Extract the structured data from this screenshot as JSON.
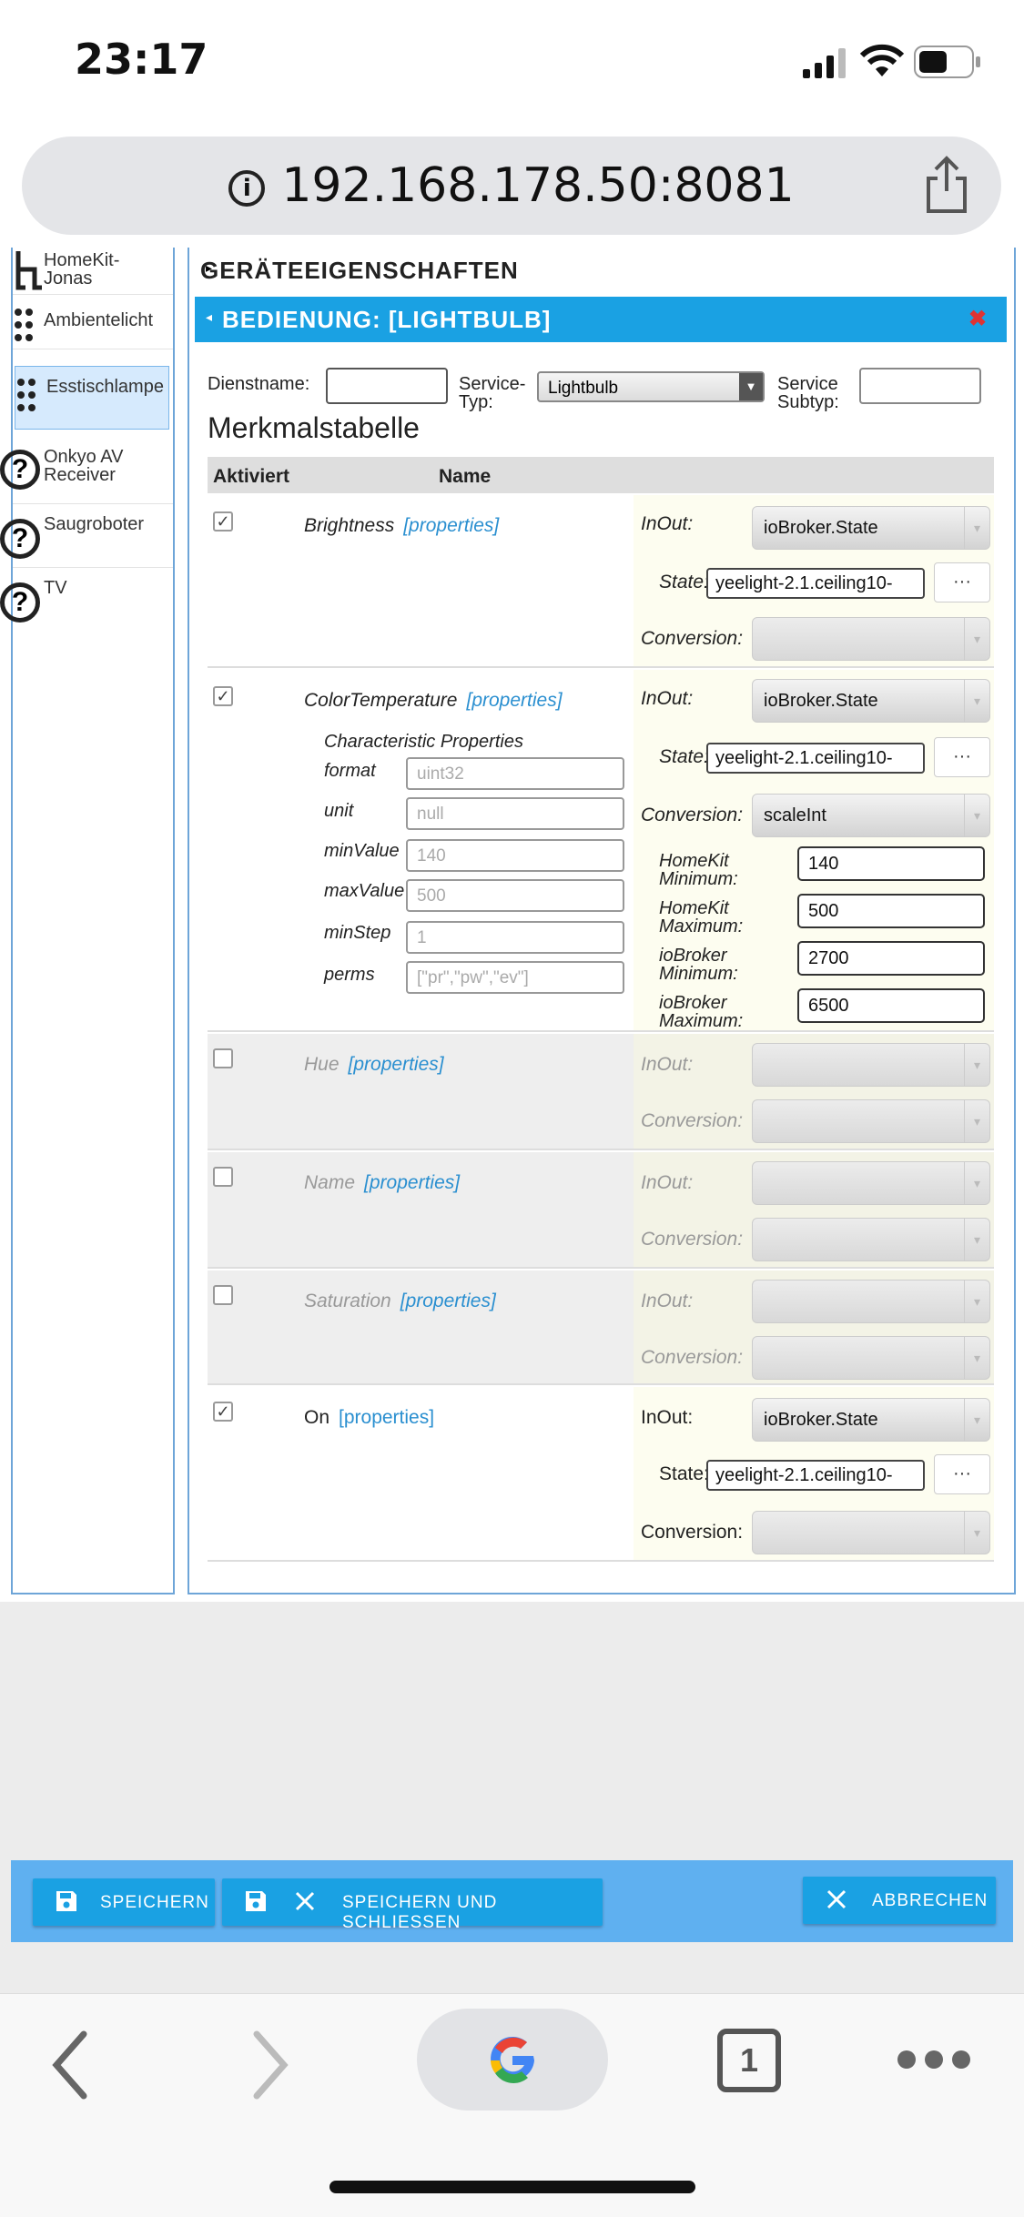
{
  "status_bar": {
    "time": "23:17"
  },
  "browser": {
    "url": "192.168.178.50:8081",
    "tab_count": "1"
  },
  "sidebar": {
    "items": [
      {
        "label": "HomeKit-\nJonas"
      },
      {
        "label": "Ambientelicht"
      },
      {
        "label": "Esstischlampe",
        "selected": true
      },
      {
        "label": "Onkyo AV\nReceiver"
      },
      {
        "label": "Saugroboter"
      },
      {
        "label": "TV"
      }
    ]
  },
  "panel": {
    "section_device": "GERÄTEEIGENSCHAFTEN",
    "section_control": "BEDIENUNG: [LIGHTBULB]",
    "service_name_label": "Dienstname:",
    "service_name_value": "",
    "service_type_label": "Service-\nTyp:",
    "service_type_value": "Lightbulb",
    "service_subtype_label": "Service\nSubtyp:",
    "service_subtype_value": "",
    "table_title": "Merkmalstabelle",
    "col_active": "Aktiviert",
    "col_name": "Name",
    "properties_link": "[properties]",
    "inout_label": "InOut:",
    "state_label": "State:",
    "conversion_label": "Conversion:",
    "dots": "···"
  },
  "rows": {
    "brightness": {
      "name": "Brightness",
      "inout": "ioBroker.State",
      "state": "yeelight-2.1.ceiling10-",
      "conversion": ""
    },
    "colortemp": {
      "name": "ColorTemperature",
      "inout": "ioBroker.State",
      "state": "yeelight-2.1.ceiling10-",
      "conversion": "scaleInt",
      "char_props_title": "Characteristic Properties",
      "props": [
        {
          "key": "format",
          "placeholder": "uint32"
        },
        {
          "key": "unit",
          "placeholder": "null"
        },
        {
          "key": "minValue",
          "placeholder": "140"
        },
        {
          "key": "maxValue",
          "placeholder": "500"
        },
        {
          "key": "minStep",
          "placeholder": "1"
        },
        {
          "key": "perms",
          "placeholder": "[\"pr\",\"pw\",\"ev\"]"
        }
      ],
      "scale": [
        {
          "label": "HomeKit\nMinimum:",
          "value": "140"
        },
        {
          "label": "HomeKit\nMaximum:",
          "value": "500"
        },
        {
          "label": "ioBroker\nMinimum:",
          "value": "2700"
        },
        {
          "label": "ioBroker\nMaximum:",
          "value": "6500"
        }
      ]
    },
    "hue": {
      "name": "Hue"
    },
    "name": {
      "name": "Name"
    },
    "saturation": {
      "name": "Saturation"
    },
    "on": {
      "name": "On",
      "inout": "ioBroker.State",
      "state": "yeelight-2.1.ceiling10-",
      "conversion": ""
    }
  },
  "footer": {
    "save": "SPEICHERN",
    "save_close": "SPEICHERN UND SCHLIESSEN",
    "cancel": "ABBRECHEN"
  },
  "colors": {
    "accent": "#1aa1e3",
    "button_bar": "#5fb0f0",
    "props_link": "#2a8fd0"
  }
}
